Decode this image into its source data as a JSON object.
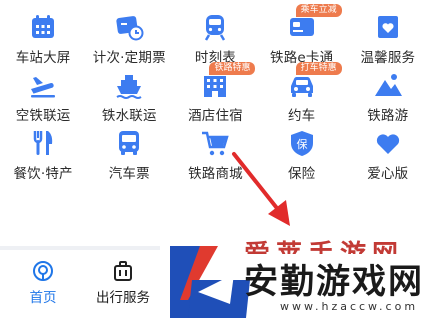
{
  "colors": {
    "icon_blue": "#3d7cf0",
    "badge_orange": "#ee7b4d",
    "active_tab": "#1f76e8",
    "arrow_red": "#e12b2b",
    "watermark_red": "#c23a35"
  },
  "grid": [
    {
      "label": "车站大屏",
      "icon": "calendar-icon",
      "badge": ""
    },
    {
      "label": "计次·定期票",
      "icon": "ticket-clock-icon",
      "badge": ""
    },
    {
      "label": "时刻表",
      "icon": "train-front-icon",
      "badge": ""
    },
    {
      "label": "铁路e卡通",
      "icon": "card-icon",
      "badge": "乘车立减"
    },
    {
      "label": "温馨服务",
      "icon": "heart-box-icon",
      "badge": ""
    },
    {
      "label": "空铁联运",
      "icon": "plane-icon",
      "badge": ""
    },
    {
      "label": "铁水联运",
      "icon": "ship-icon",
      "badge": ""
    },
    {
      "label": "酒店住宿",
      "icon": "hotel-icon",
      "badge": "铁路特惠"
    },
    {
      "label": "约车",
      "icon": "car-icon",
      "badge": "打车特惠"
    },
    {
      "label": "铁路游",
      "icon": "mountain-icon",
      "badge": ""
    },
    {
      "label": "餐饮·特产",
      "icon": "fork-knife-icon",
      "badge": ""
    },
    {
      "label": "汽车票",
      "icon": "bus-icon",
      "badge": ""
    },
    {
      "label": "铁路商城",
      "icon": "cart-icon",
      "badge": ""
    },
    {
      "label": "保险",
      "icon": "shield-icon",
      "badge": ""
    },
    {
      "label": "爱心版",
      "icon": "heart-icon",
      "badge": ""
    }
  ],
  "tabs": {
    "home": "首页",
    "travel": "出行服务"
  },
  "watermark": {
    "top": "爱莱手游网",
    "main": "安勤游戏网",
    "url": "www.hzaccw.com"
  }
}
